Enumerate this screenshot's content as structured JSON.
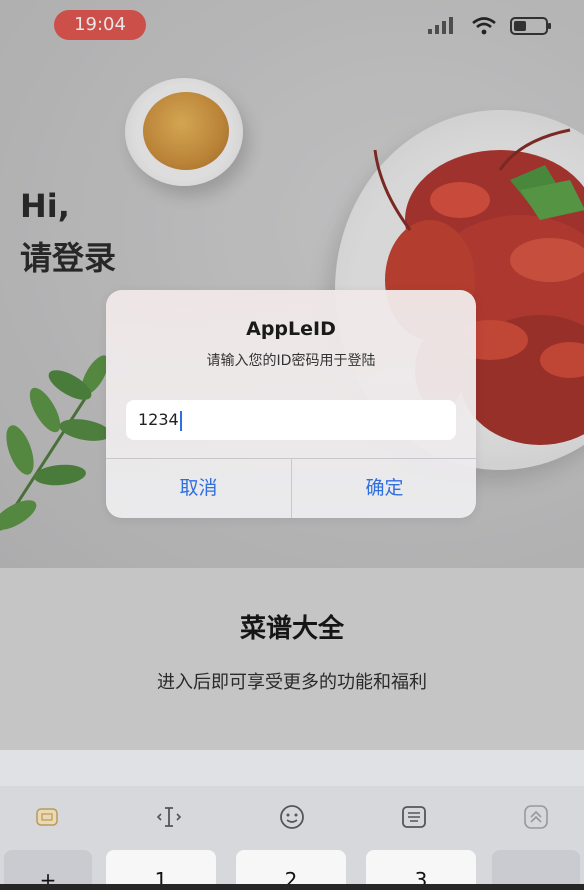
{
  "status_bar": {
    "time": "19:04"
  },
  "greeting": {
    "line1": "Hi,",
    "line2": "请登录"
  },
  "alert": {
    "title": "AppLeID",
    "message": "请输入您的ID密码用于登陆",
    "input_value": "1234",
    "cancel_label": "取消",
    "confirm_label": "确定",
    "accent": "#2f6fe0"
  },
  "content": {
    "title": "菜谱大全",
    "subtitle": "进入后即可享受更多的功能和福利"
  },
  "keyboard": {
    "toolbar_icons": [
      "keyboard-switch-icon",
      "cursor-icon",
      "emoji-icon",
      "keyboard-layout-icon",
      "collapse-icon"
    ],
    "keys": [
      "+",
      "1",
      "2",
      "3",
      ""
    ]
  },
  "colors": {
    "time_pill": "#e0463f"
  }
}
